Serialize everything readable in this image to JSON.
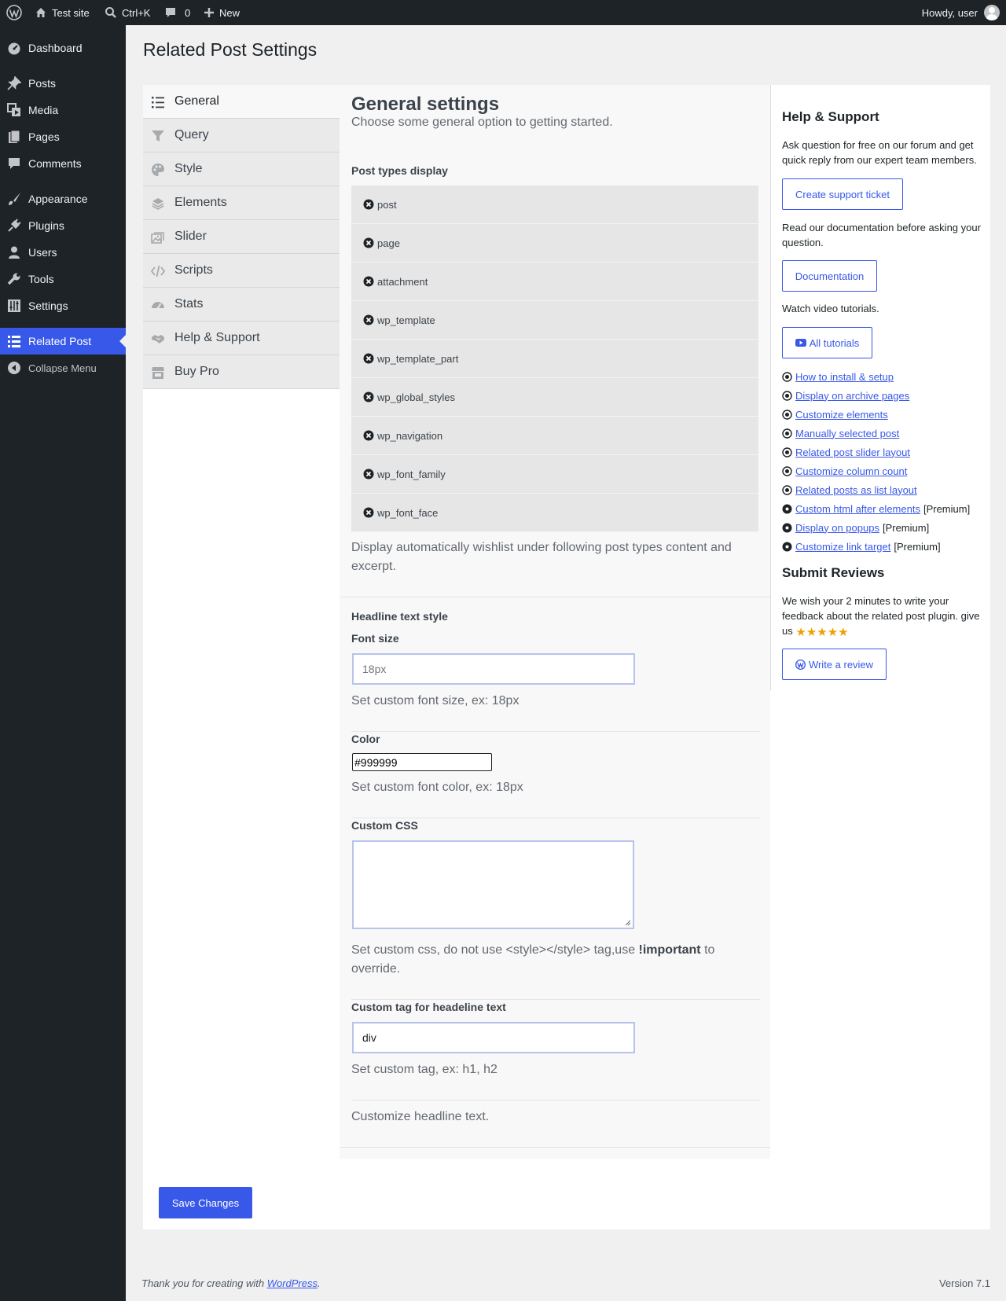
{
  "adminbar": {
    "site_name": "Test site",
    "search_shortcut": "Ctrl+K",
    "comments_count": "0",
    "new_label": "New",
    "greeting": "Howdy, user"
  },
  "admin_menu": {
    "items": [
      {
        "label": "Dashboard",
        "icon": "dashboard-icon"
      },
      {
        "label": "Posts",
        "icon": "pin-icon"
      },
      {
        "label": "Media",
        "icon": "media-icon"
      },
      {
        "label": "Pages",
        "icon": "pages-icon"
      },
      {
        "label": "Comments",
        "icon": "comment-icon"
      },
      {
        "label": "Appearance",
        "icon": "brush-icon"
      },
      {
        "label": "Plugins",
        "icon": "plug-icon"
      },
      {
        "label": "Users",
        "icon": "user-icon"
      },
      {
        "label": "Tools",
        "icon": "wrench-icon"
      },
      {
        "label": "Settings",
        "icon": "sliders-icon"
      },
      {
        "label": "Related Post",
        "icon": "list-icon"
      },
      {
        "label": "Collapse Menu",
        "icon": "collapse-icon"
      }
    ],
    "current": "Related Post"
  },
  "page": {
    "title": "Related Post Settings"
  },
  "tabs": [
    {
      "label": "General",
      "icon": "list-icon"
    },
    {
      "label": "Query",
      "icon": "filter-icon"
    },
    {
      "label": "Style",
      "icon": "palette-icon"
    },
    {
      "label": "Elements",
      "icon": "layers-icon"
    },
    {
      "label": "Slider",
      "icon": "images-icon"
    },
    {
      "label": "Scripts",
      "icon": "code-icon"
    },
    {
      "label": "Stats",
      "icon": "gauge-icon"
    },
    {
      "label": "Help & Support",
      "icon": "handshake-icon"
    },
    {
      "label": "Buy Pro",
      "icon": "store-icon"
    }
  ],
  "general": {
    "title": "General settings",
    "subtitle": "Choose some general option to getting started.",
    "post_types": {
      "label": "Post types display",
      "items": [
        "post",
        "page",
        "attachment",
        "wp_template",
        "wp_template_part",
        "wp_global_styles",
        "wp_navigation",
        "wp_font_family",
        "wp_font_face"
      ],
      "help": "Display automatically wishlist under following post types content and excerpt."
    },
    "headline": {
      "section_label": "Headline text style",
      "font_size": {
        "label": "Font size",
        "placeholder": "18px",
        "value": "",
        "help": "Set custom font size, ex: 18px"
      },
      "color": {
        "label": "Color",
        "value": "#999999",
        "help": "Set custom font color, ex: 18px"
      },
      "custom_css": {
        "label": "Custom CSS",
        "value": "",
        "help_before": "Set custom css, do not use <style></style> tag,use ",
        "help_strong": "!important",
        "help_after": " to override."
      },
      "custom_tag": {
        "label": "Custom tag for headeline text",
        "value": "div",
        "help": "Set custom tag, ex: h1, h2"
      },
      "help": "Customize headline text."
    }
  },
  "sidebar": {
    "help_title": "Help & Support",
    "forum_text": "Ask question for free on our forum and get quick reply from our expert team members.",
    "ticket_button": "Create support ticket",
    "docs_text": "Read our documentation before asking your question.",
    "docs_button": "Documentation",
    "video_text": "Watch video tutorials.",
    "tutorials_button": "All tutorials",
    "tutorials": [
      {
        "label": "How to install & setup",
        "premium": ""
      },
      {
        "label": "Display on archive pages",
        "premium": ""
      },
      {
        "label": "Customize elements",
        "premium": ""
      },
      {
        "label": "Manually selected post",
        "premium": ""
      },
      {
        "label": "Related post slider layout",
        "premium": ""
      },
      {
        "label": "Customize column count",
        "premium": ""
      },
      {
        "label": "Related posts as list layout",
        "premium": ""
      },
      {
        "label": "Custom html after elements",
        "premium": "[Premium]"
      },
      {
        "label": "Display on popups",
        "premium": "[Premium]"
      },
      {
        "label": "Customize link target",
        "premium": "[Premium]"
      }
    ],
    "reviews_title": "Submit Reviews",
    "reviews_text": "We wish your 2 minutes to write your feedback about the related post plugin. give us",
    "star_count": 5,
    "review_button": "Write a review"
  },
  "save_button": "Save Changes",
  "footer": {
    "thanks_before": "Thank you for creating with ",
    "thanks_link": "WordPress",
    "thanks_after": ".",
    "version": "Version 7.1"
  },
  "colors": {
    "accent": "#3858e9",
    "adminbar_bg": "#1d2327",
    "star": "#f0a000"
  }
}
